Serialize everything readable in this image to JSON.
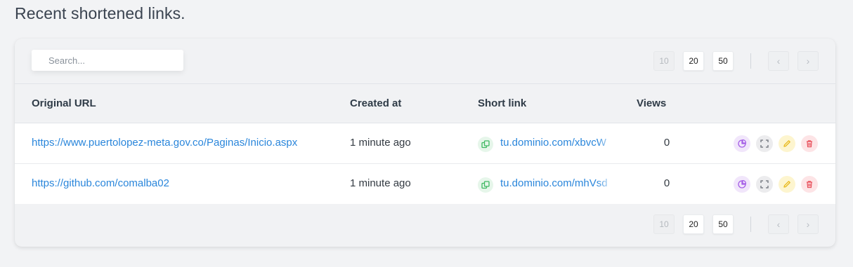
{
  "page": {
    "title": "Recent shortened links."
  },
  "search": {
    "placeholder": "Search..."
  },
  "pagination": {
    "sizes": [
      "10",
      "20",
      "50"
    ],
    "prev_icon": "‹",
    "next_icon": "›"
  },
  "table": {
    "headers": {
      "original_url": "Original URL",
      "created_at": "Created at",
      "short_link": "Short link",
      "views": "Views"
    },
    "rows": [
      {
        "original_url": "https://www.puertolopez-meta.gov.co/Paginas/Inicio.aspx",
        "created_at": "1 minute ago",
        "short_link": "tu.dominio.com/xbvcW",
        "views": "0"
      },
      {
        "original_url": "https://github.com/comalba02",
        "created_at": "1 minute ago",
        "short_link": "tu.dominio.com/mhVsd",
        "views": "0"
      }
    ]
  },
  "icons": {
    "copy": "copy-icon",
    "stats": "pie-chart-icon",
    "qr": "qr-scan-icon",
    "edit": "pencil-icon",
    "delete": "trash-icon"
  },
  "colors": {
    "link": "#2a86db",
    "stats": "#a45de6",
    "qr": "#6b7079",
    "edit": "#e8b91c",
    "delete": "#e8505b",
    "copy": "#3fb862"
  }
}
